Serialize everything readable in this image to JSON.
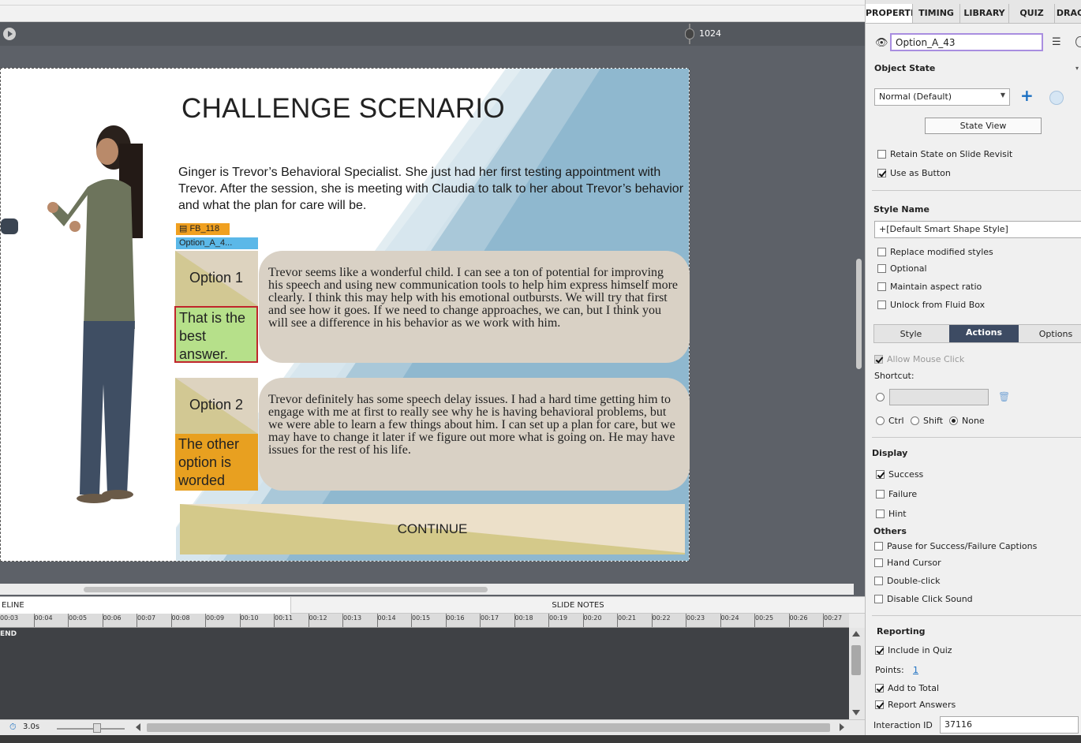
{
  "timeline": {
    "marker_value": "1024"
  },
  "slide": {
    "title": "CHALLENGE SCENARIO",
    "paragraph": "Ginger is Trevor’s Behavioral Specialist. She just had her first testing appointment with Trevor. After the session, she is meeting with Claudia to talk to her about Trevor’s behavior and what the plan for care will be.",
    "fb_tag": "FB_118",
    "option_tag": "Option_A_4...",
    "option1": {
      "label": "Option 1",
      "text": "Trevor seems like a wonderful child. I can see a ton of potential for improving his speech and using new communication tools to help him express himself more clearly. I think this may help with his emotional outbursts. We will try that first and see how it goes. If we need to change approaches, we can, but I think you will see a difference in his behavior as we work with him.",
      "feedback": "That is the best answer."
    },
    "option2": {
      "label": "Option 2",
      "text": "Trevor definitely has some speech delay issues.  I had a hard time getting him to engage with me at first to really see why he is having behavioral problems, but we were able to learn a few things about him. I can set up a plan for care, but we may have to change it later if we figure out more what is going on. He may have issues for the rest of his life.",
      "feedback": "The other option is worded"
    },
    "continue_label": "CONTINUE"
  },
  "bottom": {
    "tab_timeline": "ELINE",
    "tab_notes": "SLIDE NOTES",
    "ruler": [
      "00:03",
      "00:04",
      "00:05",
      "00:06",
      "00:07",
      "00:08",
      "00:09",
      "00:10",
      "00:11",
      "00:12",
      "00:13",
      "00:14",
      "00:15",
      "00:16",
      "00:17",
      "00:18",
      "00:19",
      "00:20",
      "00:21",
      "00:22",
      "00:23",
      "00:24",
      "00:25",
      "00:26",
      "00:27"
    ],
    "end_label": "END",
    "duration": "3.0s"
  },
  "panel": {
    "tabs": [
      "PROPERTI...",
      "TIMING",
      "LIBRARY",
      "QUIZ",
      "DRAG"
    ],
    "object_name": "Option_A_43",
    "object_state_title": "Object State",
    "state_select": "Normal (Default)",
    "state_view_button": "State View",
    "retain_state": "Retain State on Slide Revisit",
    "use_as_button": "Use as Button",
    "style_name_title": "Style Name",
    "style_value": "+[Default Smart Shape Style]",
    "replace_styles": "Replace modified styles",
    "optional": "Optional",
    "maintain_aspect": "Maintain aspect ratio",
    "unlock_fluid": "Unlock from Fluid Box",
    "subtabs": [
      "Style",
      "Actions",
      "Options"
    ],
    "allow_mouse": "Allow Mouse Click",
    "shortcut_label": "Shortcut:",
    "mod_ctrl": "Ctrl",
    "mod_shift": "Shift",
    "mod_none": "None",
    "display_title": "Display",
    "success": "Success",
    "failure": "Failure",
    "hint": "Hint",
    "others_title": "Others",
    "pause": "Pause for Success/Failure Captions",
    "hand_cursor": "Hand Cursor",
    "double_click": "Double-click",
    "disable_sound": "Disable Click Sound",
    "reporting_title": "Reporting",
    "include_quiz": "Include in Quiz",
    "points_label": "Points:",
    "points_value": "1",
    "add_total": "Add to Total",
    "report_answers": "Report Answers",
    "interaction_label": "Interaction ID",
    "interaction_value": "37116"
  },
  "colors": {
    "accent_tab": "#3d4b63",
    "link": "#1a6fc2",
    "feedback_correct": "#b6e08a",
    "feedback_other": "#e8a020",
    "option_bubble": "#d9d1c5"
  }
}
